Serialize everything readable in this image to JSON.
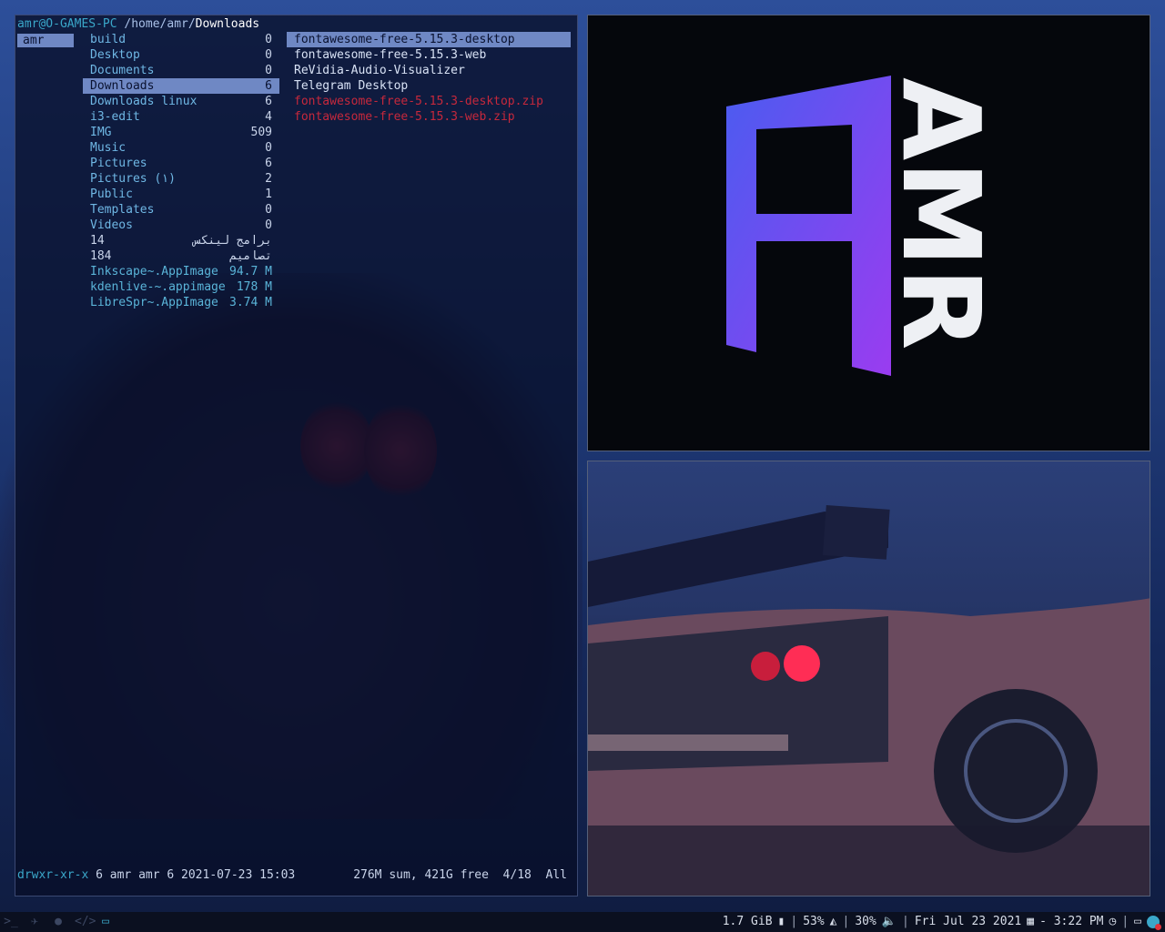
{
  "ranger": {
    "header": {
      "user_host": "amr@O-GAMES-PC",
      "path": " /home/amr/",
      "current": "Downloads"
    },
    "parent_selected": "amr",
    "middle": [
      {
        "name": "build",
        "count": "0",
        "style": "dir"
      },
      {
        "name": "Desktop",
        "count": "0",
        "style": "dir"
      },
      {
        "name": "Documents",
        "count": "0",
        "style": "dir"
      },
      {
        "name": "Downloads",
        "count": "6",
        "style": "sel"
      },
      {
        "name": "Downloads linux",
        "count": "6",
        "style": "dir"
      },
      {
        "name": "i3-edit",
        "count": "4",
        "style": "dir"
      },
      {
        "name": "IMG",
        "count": "509",
        "style": "dir"
      },
      {
        "name": "Music",
        "count": "0",
        "style": "dir"
      },
      {
        "name": "Pictures",
        "count": "6",
        "style": "dir"
      },
      {
        "name": "Pictures (١)",
        "count": "2",
        "style": "dir"
      },
      {
        "name": "Public",
        "count": "1",
        "style": "dir"
      },
      {
        "name": "Templates",
        "count": "0",
        "style": "dir"
      },
      {
        "name": "Videos",
        "count": "0",
        "style": "dir"
      },
      {
        "name": "14",
        "count": "برامج لينكس",
        "style": "plain"
      },
      {
        "name": "184",
        "count": "تصاميم",
        "style": "plain"
      },
      {
        "name": "Inkscape~.AppImage",
        "count": "94.7 M",
        "style": "file"
      },
      {
        "name": "kdenlive-~.appimage",
        "count": "178 M",
        "style": "file"
      },
      {
        "name": "LibreSpr~.AppImage",
        "count": "3.74 M",
        "style": "file"
      }
    ],
    "right": [
      {
        "name": "fontawesome-free-5.15.3-desktop",
        "style": "sel"
      },
      {
        "name": "fontawesome-free-5.15.3-web",
        "style": "dir"
      },
      {
        "name": "ReVidia-Audio-Visualizer",
        "style": "dir"
      },
      {
        "name": "Telegram Desktop",
        "style": "dir"
      },
      {
        "name": "fontawesome-free-5.15.3-desktop.zip",
        "style": "zip"
      },
      {
        "name": "fontawesome-free-5.15.3-web.zip",
        "style": "zip"
      }
    ],
    "status": {
      "perm": "drwxr-xr-x",
      "info": " 6 amr amr 6 2021-07-23 15:03",
      "right": "276M sum, 421G free  4/18  All"
    }
  },
  "logo": {
    "text": "AMR"
  },
  "taskbar": {
    "memory": "1.7 GiB",
    "cpu": "53%",
    "volume": "30%",
    "date": "Fri Jul 23 2021",
    "time": "- 3:22 PM"
  },
  "colors": {
    "accent": "#3aa7c9",
    "selection": "#6f88c4",
    "zip": "#c6283c"
  }
}
